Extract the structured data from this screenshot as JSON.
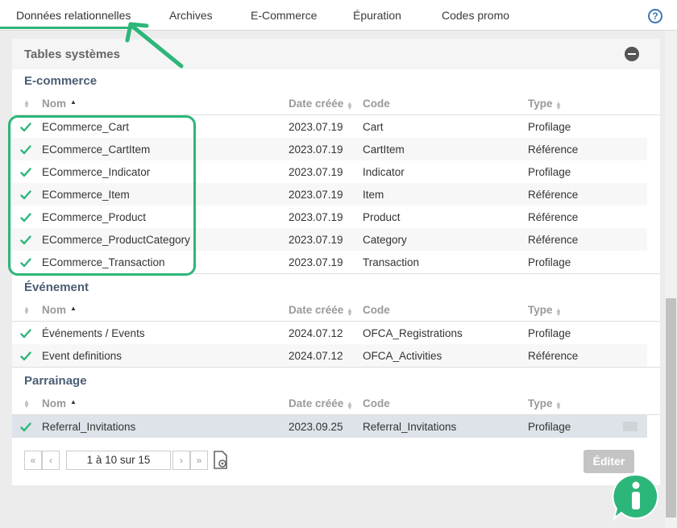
{
  "tabs": [
    {
      "label": "Données relationnelles",
      "active": true
    },
    {
      "label": "Archives"
    },
    {
      "label": "E-Commerce"
    },
    {
      "label": "Épuration"
    },
    {
      "label": "Codes promo"
    }
  ],
  "help_label": "?",
  "panel": {
    "title": "Tables systèmes"
  },
  "columns": {
    "name": "Nom",
    "date": "Date créée",
    "code": "Code",
    "type": "Type"
  },
  "sections": [
    {
      "title": "E-commerce",
      "rows": [
        {
          "name": "ECommerce_Cart",
          "date": "2023.07.19",
          "code": "Cart",
          "type": "Profilage"
        },
        {
          "name": "ECommerce_CartItem",
          "date": "2023.07.19",
          "code": "CartItem",
          "type": "Référence"
        },
        {
          "name": "ECommerce_Indicator",
          "date": "2023.07.19",
          "code": "Indicator",
          "type": "Profilage"
        },
        {
          "name": "ECommerce_Item",
          "date": "2023.07.19",
          "code": "Item",
          "type": "Référence"
        },
        {
          "name": "ECommerce_Product",
          "date": "2023.07.19",
          "code": "Product",
          "type": "Référence"
        },
        {
          "name": "ECommerce_ProductCategory",
          "date": "2023.07.19",
          "code": "Category",
          "type": "Référence"
        },
        {
          "name": "ECommerce_Transaction",
          "date": "2023.07.19",
          "code": "Transaction",
          "type": "Profilage"
        }
      ]
    },
    {
      "title": "Événement",
      "rows": [
        {
          "name": "Événements / Events",
          "date": "2024.07.12",
          "code": "OFCA_Registrations",
          "type": "Profilage"
        },
        {
          "name": "Event definitions",
          "date": "2024.07.12",
          "code": "OFCA_Activities",
          "type": "Référence"
        }
      ]
    },
    {
      "title": "Parrainage",
      "rows": [
        {
          "name": "Referral_Invitations",
          "date": "2023.09.25",
          "code": "Referral_Invitations",
          "type": "Profilage",
          "selected": true
        }
      ]
    }
  ],
  "pagination": {
    "first": "«",
    "prev": "‹",
    "range": "1 à 10 sur 15",
    "next": "›",
    "last": "»"
  },
  "edit_button": "Éditer",
  "colors": {
    "accent": "#2db67a",
    "section_title": "#4a5d73"
  }
}
